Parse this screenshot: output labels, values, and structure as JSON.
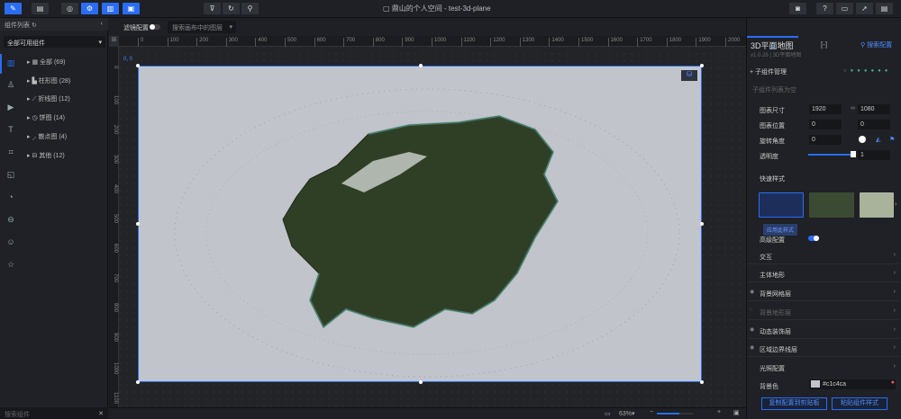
{
  "header": {
    "title": "鼎山的个人空间 - test-3d-plane"
  },
  "left_panel": {
    "title": "组件列表",
    "filter_value": "全部可用组件",
    "search_placeholder": "搜索组件",
    "tree": [
      {
        "label": "全部 (69)"
      },
      {
        "label": "柱形图 (28)"
      },
      {
        "label": "折线图 (12)"
      },
      {
        "label": "饼图 (14)"
      },
      {
        "label": "散点图 (4)"
      },
      {
        "label": "其他 (12)"
      }
    ]
  },
  "toolbar": {
    "filter_label": "滤镜配置",
    "layer_search_placeholder": "搜索画布中的图层"
  },
  "canvas": {
    "origin_label": "0, 0",
    "ruler_top": [
      "0",
      "100",
      "200",
      "300",
      "400",
      "500",
      "600",
      "700",
      "800",
      "900",
      "1000",
      "1100",
      "1200",
      "1300",
      "1400",
      "1500",
      "1600",
      "1700",
      "1800",
      "1900",
      "2000"
    ],
    "ruler_left": [
      "0",
      "100",
      "200",
      "300",
      "400",
      "500",
      "600",
      "700",
      "800",
      "900",
      "1000",
      "1100"
    ]
  },
  "bottom": {
    "zoom": "63%",
    "zoom_fraction": 0.63
  },
  "right_panel": {
    "component_title": "3D平面地图",
    "version": "v1.0.28 | 3D平面地图",
    "search_config": "搜索配置",
    "sub_manage": "子组件管理",
    "sub_empty": "子组件列表为空",
    "size_label": "图表尺寸",
    "width": "1920",
    "height": "1080",
    "position_label": "图表位置",
    "pos_x": "0",
    "pos_y": "0",
    "rotate_label": "旋转角度",
    "rotate": "0",
    "opacity_label": "透明度",
    "opacity": "1",
    "quick_style": "快速样式",
    "apply_style": "应用此样式",
    "advanced": "高级配置",
    "sections": [
      "交互",
      "主体地形",
      "背景网格层",
      "背景地形层",
      "动态装饰层",
      "区域边界线层",
      "光照配置"
    ],
    "bg_color_label": "背景色",
    "bg_color": "#c1c4ca",
    "copy_btn": "复制配置到剪贴板",
    "paste_btn": "粘贴组件样式"
  },
  "colors": {
    "accent": "#2a6df4",
    "board": "#c1c4ca"
  }
}
